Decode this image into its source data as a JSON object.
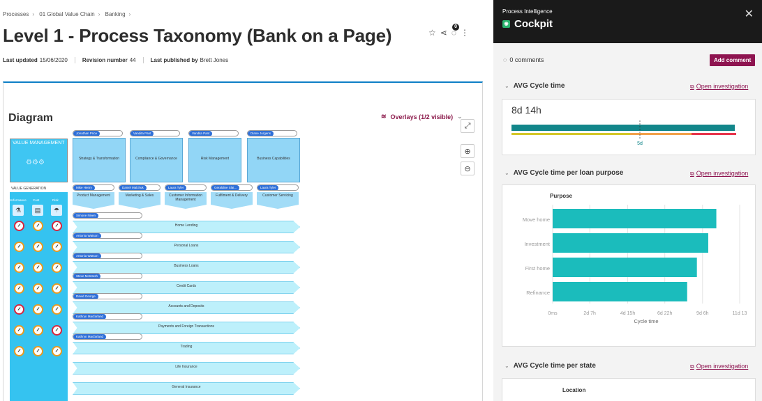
{
  "breadcrumb": {
    "items": [
      "Processes",
      "01 Global Value Chain",
      "Banking"
    ]
  },
  "page": {
    "title": "Level 1 - Process Taxonomy (Bank on a Page)",
    "notif_count": "0"
  },
  "meta": {
    "last_updated_label": "Last updated",
    "last_updated": "15/06/2020",
    "revision_label": "Revision number",
    "revision": "44",
    "published_label": "Last published by",
    "published": "Brett Jones"
  },
  "diagram": {
    "title": "Diagram",
    "overlays": "Overlays (1/2 visible)",
    "value_management": "VALUE MANAGEMENT",
    "value_generation": "VALUE GENERATION",
    "kpi_headers": [
      "Performance",
      "Cost",
      "Risk"
    ],
    "top_owners": [
      "Jonathan Price",
      "Vandita Pant",
      "Vandita Pant",
      "Diane Jurgens"
    ],
    "top_boxes": [
      "Strategy & Transformation",
      "Compliance & Governance",
      "Risk Management",
      "Business Capabilities"
    ],
    "mid_owners": [
      "Mike Henry",
      "Daniel Malchuk",
      "Laura Tyler",
      "Geraldine Slat...",
      "Laura Tyler"
    ],
    "mid_boxes": [
      "Product Management",
      "Marketing & Sales",
      "Customer Information Management",
      "Fulfilment & Delivery",
      "Customer Servicing"
    ],
    "lanes": [
      {
        "owner": "Simone Niven",
        "label": "Home Lending"
      },
      {
        "owner": "Antonia Watson",
        "label": "Personal Loans"
      },
      {
        "owner": "Antonia Watson",
        "label": "Business Loans"
      },
      {
        "owner": "Steve McIntosh",
        "label": "Credit Cards"
      },
      {
        "owner": "David George",
        "label": "Accounts and Deposits"
      },
      {
        "owner": "Kathryn Macfarland",
        "label": "Payments and Foreign Transactions"
      },
      {
        "owner": "Kathryn Macfarland",
        "label": "Trading"
      },
      {
        "owner": "",
        "label": "Life Insurance"
      },
      {
        "owner": "",
        "label": "General Insurance"
      }
    ],
    "gauge_status": [
      [
        "red",
        "orange",
        "red"
      ],
      [
        "orange",
        "orange",
        "orange"
      ],
      [
        "orange",
        "orange",
        "orange"
      ],
      [
        "orange",
        "orange",
        "orange"
      ],
      [
        "red",
        "orange",
        "orange"
      ],
      [
        "orange",
        "orange",
        "red"
      ],
      [
        "orange",
        "orange",
        "orange"
      ]
    ]
  },
  "panel": {
    "subtitle": "Process Intelligence",
    "title": "Cockpit",
    "comments": "0 comments",
    "add_comment": "Add comment",
    "open_investigation": "Open investigation",
    "sections": {
      "s1": "AVG Cycle time",
      "s2": "AVG Cycle time per loan purpose",
      "s3": "AVG Cycle time per state"
    },
    "cycle_value": "8d 14h",
    "cycle_marker": "5d",
    "bar_colors": {
      "main": "#12868a",
      "yellow": "#d4c72a",
      "orange": "#f2a24c",
      "red": "#e8364d"
    }
  },
  "chart_data": [
    {
      "type": "bar",
      "orientation": "horizontal",
      "title": "Purpose",
      "xlabel": "Cycle time",
      "categories": [
        "Move home",
        "Investment",
        "First home",
        "Refinance"
      ],
      "values_days": [
        10.1,
        9.6,
        8.9,
        8.3
      ],
      "x_ticks": [
        "0ms",
        "2d 7h",
        "4d 15h",
        "6d 22h",
        "9d 6h",
        "11d 13"
      ],
      "x_tick_days": [
        0,
        2.29,
        4.63,
        6.92,
        9.25,
        11.54
      ],
      "color": "#1bbcbc",
      "grid": true
    },
    {
      "type": "bar",
      "title": "Location"
    }
  ]
}
